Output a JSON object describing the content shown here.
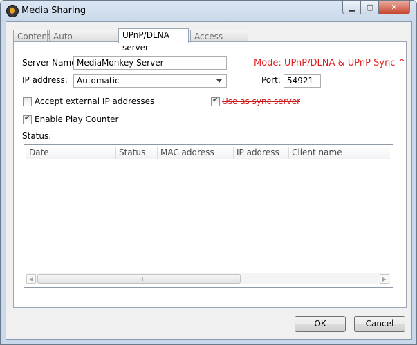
{
  "window": {
    "title": "Media Sharing"
  },
  "titlebar": {
    "minimize_glyph": "▁",
    "maximize_glyph": "▢",
    "close_glyph": "✕"
  },
  "tabs": [
    {
      "label": "Content"
    },
    {
      "label": "Auto-Conversion"
    },
    {
      "label": "UPnP/DLNA server"
    },
    {
      "label": "Access control"
    }
  ],
  "form": {
    "server_name_label": "Server Name:",
    "server_name_value": "MediaMonkey Server",
    "ip_label": "IP address:",
    "ip_value": "Automatic",
    "mode_text": "Mode: UPnP/DLNA & UPnP Sync ^",
    "port_label": "Port:",
    "port_value": "54921",
    "accept_external_label": "Accept external IP addresses",
    "accept_external_checked": false,
    "sync_server_label": "Use as sync server",
    "sync_server_checked": true,
    "play_counter_label": "Enable Play Counter",
    "play_counter_checked": true,
    "status_label": "Status:"
  },
  "status_table": {
    "columns": [
      "Date",
      "Status",
      "MAC address",
      "IP address",
      "Client name"
    ],
    "rows": []
  },
  "buttons": {
    "ok": "OK",
    "cancel": "Cancel"
  },
  "colors": {
    "mode_text": "#e02020",
    "strike_text": "#d01c1c"
  }
}
